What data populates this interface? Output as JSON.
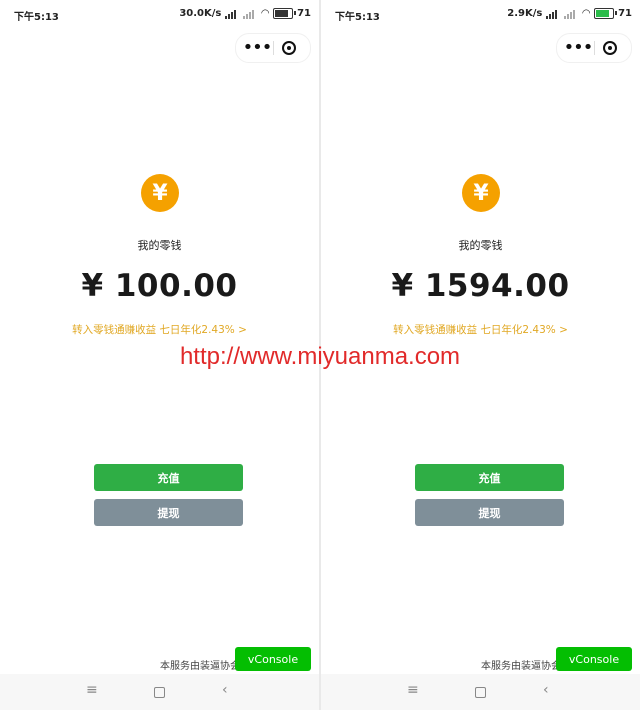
{
  "screens": [
    {
      "status": {
        "time": "下午5:13",
        "speed": "30.0K/s",
        "battery": "71"
      },
      "wallet_label": "我的零钱",
      "balance": "¥ 100.00",
      "promo": "转入零钱通赚收益 七日年化2.43% >",
      "recharge_label": "充值",
      "withdraw_label": "提现",
      "provider_text": "本服务由装逼协会提供",
      "vconsole_label": "vConsole",
      "coin_symbol": "¥"
    },
    {
      "status": {
        "time": "下午5:13",
        "speed": "2.9K/s",
        "battery": "71"
      },
      "wallet_label": "我的零钱",
      "balance": "¥ 1594.00",
      "promo": "转入零钱通赚收益 七日年化2.43% >",
      "recharge_label": "充值",
      "withdraw_label": "提现",
      "provider_text": "本服务由装逼协会提供",
      "vconsole_label": "vConsole",
      "coin_symbol": "¥"
    }
  ],
  "watermark": "http://www.miyuanma.com",
  "colors": {
    "coin": "#f5a100",
    "recharge": "#2fae45",
    "withdraw": "#7f8f99",
    "promo": "#e1a824",
    "vconsole": "#04be02",
    "watermark": "#e12a2a"
  },
  "icons": {
    "more": "more-dots-icon",
    "close": "target-close-icon",
    "wifi": "wifi-icon",
    "signal": "signal-icon",
    "battery": "battery-icon",
    "nav_menu": "menu-icon",
    "nav_home": "home-square-icon",
    "nav_back": "back-chevron-icon"
  }
}
